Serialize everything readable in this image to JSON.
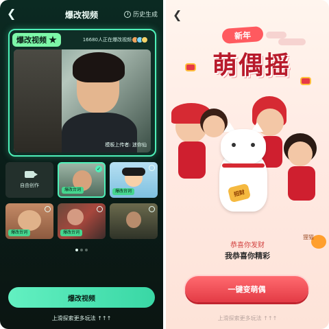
{
  "left": {
    "header": {
      "title": "爆改视频",
      "history_label": "历史生成"
    },
    "hero": {
      "badge": "爆改视频",
      "users": "16680人正在爆改视频",
      "uploader": "模板上传者: 迷你仙"
    },
    "grid": {
      "create_label": "自由创作",
      "tag": "爆改台词"
    },
    "primary_button": "爆改视频",
    "scroll_hint": "上滑探索更多玩法 ↑↑↑",
    "colors": {
      "accent": "#4ef0b8",
      "button": "#39d7a5"
    }
  },
  "right": {
    "badge": "新年",
    "title": "萌偶摇",
    "coin_label": "招财",
    "side_label": "狸猫",
    "subtitle": "恭喜你发财",
    "caption": "我恭喜你精彩",
    "primary_button": "一键变萌偶",
    "scroll_hint": "上滑探索更多玩法 ↑↑↑",
    "colors": {
      "accent": "#e33b45",
      "title": "#b81a2b"
    }
  }
}
